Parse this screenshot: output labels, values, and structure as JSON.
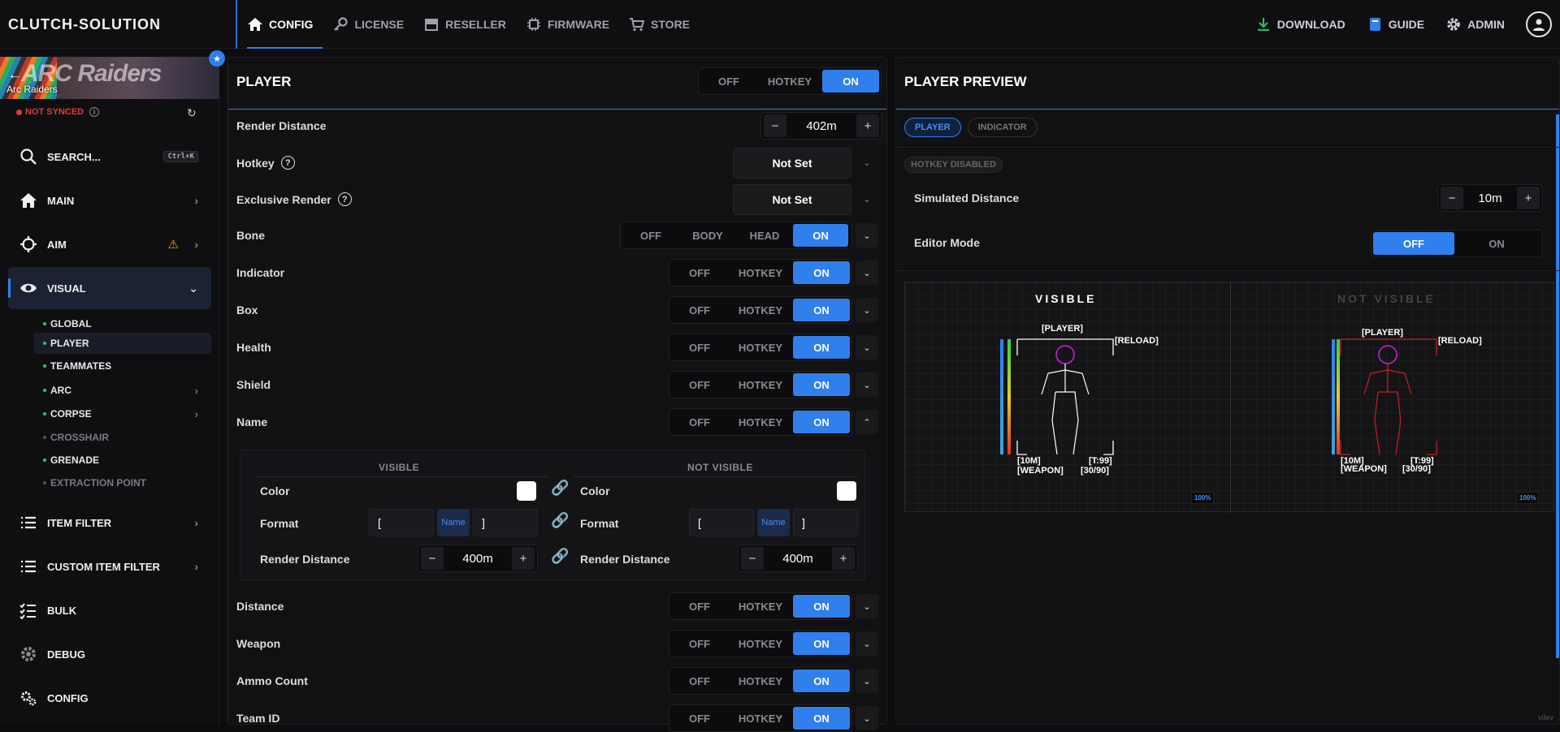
{
  "app": {
    "brand": "CLUTCH-SOLUTION",
    "watermark": "vdev"
  },
  "topnav": [
    {
      "label": "CONFIG",
      "icon": "home-icon"
    },
    {
      "label": "LICENSE",
      "icon": "key-icon"
    },
    {
      "label": "RESELLER",
      "icon": "store-icon"
    },
    {
      "label": "FIRMWARE",
      "icon": "chip-icon"
    },
    {
      "label": "STORE",
      "icon": "cart-icon"
    }
  ],
  "topright": {
    "download": "DOWNLOAD",
    "guide": "GUIDE",
    "admin": "ADMIN"
  },
  "sidebar": {
    "game": "Arc Raiders",
    "banner_logo": "ARC Raiders",
    "sync_status": "NOT SYNCED",
    "search": {
      "label": "SEARCH...",
      "shortcut": "Ctrl+K"
    },
    "items": [
      {
        "label": "MAIN"
      },
      {
        "label": "AIM"
      },
      {
        "label": "VISUAL"
      },
      {
        "label": "ITEM FILTER"
      },
      {
        "label": "CUSTOM ITEM FILTER"
      },
      {
        "label": "BULK"
      },
      {
        "label": "DEBUG"
      },
      {
        "label": "CONFIG"
      }
    ],
    "visual_subitems": [
      {
        "label": "GLOBAL"
      },
      {
        "label": "PLAYER"
      },
      {
        "label": "TEAMMATES"
      },
      {
        "label": "ARC"
      },
      {
        "label": "CORPSE"
      },
      {
        "label": "CROSSHAIR"
      },
      {
        "label": "GRENADE"
      },
      {
        "label": "EXTRACTION POINT"
      }
    ]
  },
  "player": {
    "title": "PLAYER",
    "master_toggle": {
      "off": "OFF",
      "hotkey": "HOTKEY",
      "on": "ON"
    },
    "render_distance": {
      "label": "Render Distance",
      "value": "402m"
    },
    "hotkey": {
      "label": "Hotkey",
      "value": "Not Set"
    },
    "exclusive_render": {
      "label": "Exclusive Render",
      "value": "Not Set"
    },
    "bone": {
      "label": "Bone",
      "options": [
        "OFF",
        "BODY",
        "HEAD",
        "ON"
      ]
    },
    "rows": [
      {
        "label": "Indicator"
      },
      {
        "label": "Box"
      },
      {
        "label": "Health"
      },
      {
        "label": "Shield"
      },
      {
        "label": "Name"
      },
      {
        "label": "Distance"
      },
      {
        "label": "Weapon"
      },
      {
        "label": "Ammo Count"
      },
      {
        "label": "Team ID"
      }
    ],
    "toggle_labels": {
      "off": "OFF",
      "hotkey": "HOTKEY",
      "on": "ON"
    },
    "name_settings": {
      "visible_header": "VISIBLE",
      "not_visible_header": "NOT VISIBLE",
      "color_label": "Color",
      "format_label": "Format",
      "render_distance_label": "Render Distance",
      "visible": {
        "prefix": "[",
        "token": "Name",
        "suffix": "]",
        "distance": "400m",
        "color": "#ffffff"
      },
      "not_visible": {
        "prefix": "[",
        "token": "Name",
        "suffix": "]",
        "distance": "400m",
        "color": "#ffffff"
      }
    }
  },
  "preview": {
    "title": "PLAYER PREVIEW",
    "tabs": [
      "PLAYER",
      "INDICATOR"
    ],
    "hotkey_badge": "HOTKEY DISABLED",
    "simulated_distance": {
      "label": "Simulated Distance",
      "value": "10m"
    },
    "editor_mode": {
      "label": "Editor Mode",
      "off": "OFF",
      "on": "ON"
    },
    "visible": {
      "title": "VISIBLE",
      "player": "[PLAYER]",
      "reload": "[RELOAD]",
      "dist": "[10M]",
      "team": "[T:99]",
      "weapon": "[WEAPON]",
      "ammo": "[30/90]",
      "zoom": "100%"
    },
    "not_visible": {
      "title": "NOT VISIBLE",
      "player": "[PLAYER]",
      "reload": "[RELOAD]",
      "dist": "[10M]",
      "team": "[T:99]",
      "weapon": "[WEAPON]",
      "ammo": "[30/90]",
      "zoom": "100%"
    }
  },
  "colors": {
    "accent": "#2f80ed",
    "visible_skeleton": "#ffffff",
    "not_visible_skeleton": "#cc1f1f",
    "head": "#d21fd2",
    "not_synced": "#e23b3b"
  }
}
